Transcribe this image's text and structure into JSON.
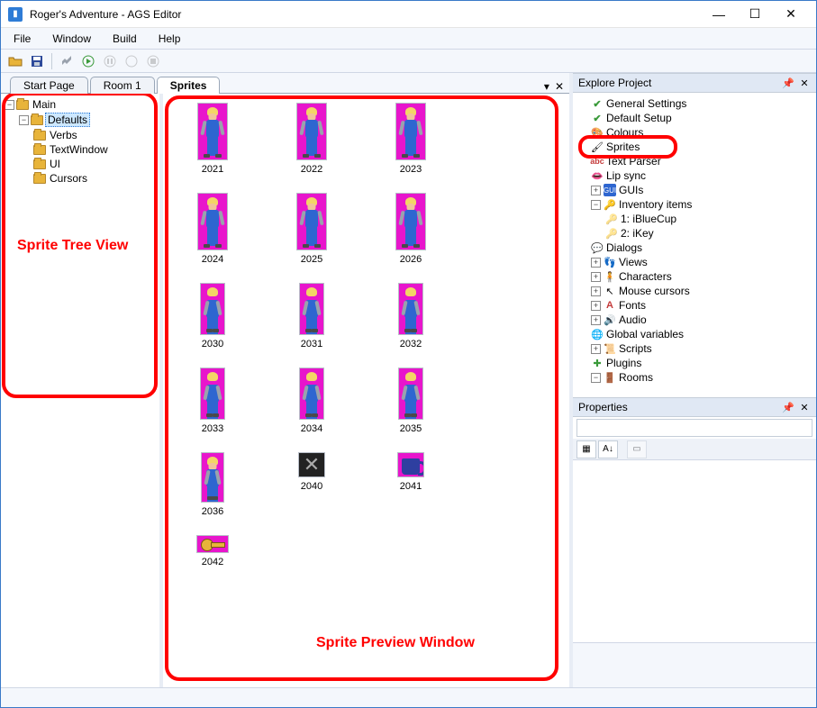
{
  "window": {
    "title": "Roger's Adventure - AGS Editor"
  },
  "menu": {
    "file": "File",
    "window": "Window",
    "build": "Build",
    "help": "Help"
  },
  "tabs": {
    "start": "Start Page",
    "room": "Room 1",
    "sprites": "Sprites"
  },
  "tree": {
    "main": "Main",
    "defaults": "Defaults",
    "verbs": "Verbs",
    "textwindow": "TextWindow",
    "ui": "UI",
    "cursors": "Cursors"
  },
  "sprites": {
    "r1": [
      "2021",
      "2022",
      "2023"
    ],
    "r2": [
      "2024",
      "2025",
      "2026"
    ],
    "r3": [
      "2030",
      "2031",
      "2032"
    ],
    "r4": [
      "2033",
      "2034",
      "2035"
    ],
    "r5": [
      "2036",
      "2040",
      "2041"
    ],
    "r6": [
      "2042"
    ]
  },
  "annotations": {
    "tree_label": "Sprite Tree View",
    "preview_label": "Sprite Preview Window"
  },
  "panels": {
    "explore": "Explore Project",
    "properties": "Properties"
  },
  "explore": {
    "general": "General Settings",
    "setup": "Default Setup",
    "colours": "Colours",
    "sprites": "Sprites",
    "textparser": "Text Parser",
    "lipsync": "Lip sync",
    "guis": "GUIs",
    "inventory": "Inventory items",
    "inv1": "1: iBlueCup",
    "inv2": "2: iKey",
    "dialogs": "Dialogs",
    "views": "Views",
    "characters": "Characters",
    "cursors": "Mouse cursors",
    "fonts": "Fonts",
    "audio": "Audio",
    "globals": "Global variables",
    "scripts": "Scripts",
    "plugins": "Plugins",
    "rooms": "Rooms"
  }
}
